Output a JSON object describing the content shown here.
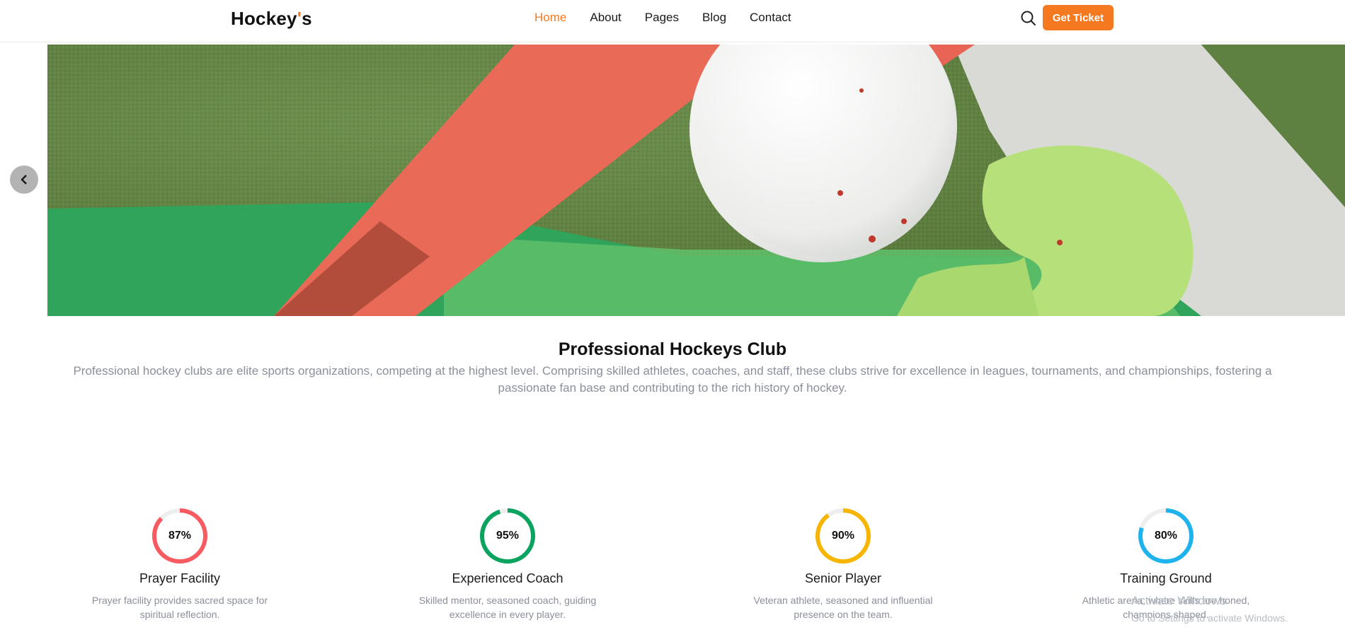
{
  "header": {
    "logo_main": "Hockey",
    "logo_accent": "'",
    "logo_tail": "s",
    "nav": [
      "Home",
      "About",
      "Pages",
      "Blog",
      "Contact"
    ],
    "active_nav": "Home",
    "ticket_label": "Get Ticket"
  },
  "slider": {
    "slide_count": 2,
    "active_slide": 2
  },
  "about": {
    "title": "Professional Hockeys Club",
    "text": "Professional hockey clubs are elite sports organizations, competing at the highest level. Comprising skilled athletes, coaches, and staff, these clubs strive for excellence in leagues, tournaments, and championships, fostering a passionate fan base and contributing to the rich history of hockey."
  },
  "stats": [
    {
      "percent": 87,
      "label": "87%",
      "title": "Prayer Facility",
      "desc": "Prayer facility provides sacred space for spiritual reflection.",
      "color": "#f75a5f"
    },
    {
      "percent": 95,
      "label": "95%",
      "title": "Experienced Coach",
      "desc": "Skilled mentor, seasoned coach, guiding excellence in every player.",
      "color": "#0aa35f"
    },
    {
      "percent": 90,
      "label": "90%",
      "title": "Senior Player",
      "desc": "Veteran athlete, seasoned and influential presence on the team.",
      "color": "#f7b500"
    },
    {
      "percent": 80,
      "label": "80%",
      "title": "Training Ground",
      "desc": "Athletic arena, where skills are honed, champions shaped.",
      "color": "#1fb3ee"
    }
  ],
  "watermark": {
    "line1": "Activate Windows",
    "line2": "Go to Settings to activate Windows."
  },
  "colors": {
    "accent": "#f47920"
  }
}
